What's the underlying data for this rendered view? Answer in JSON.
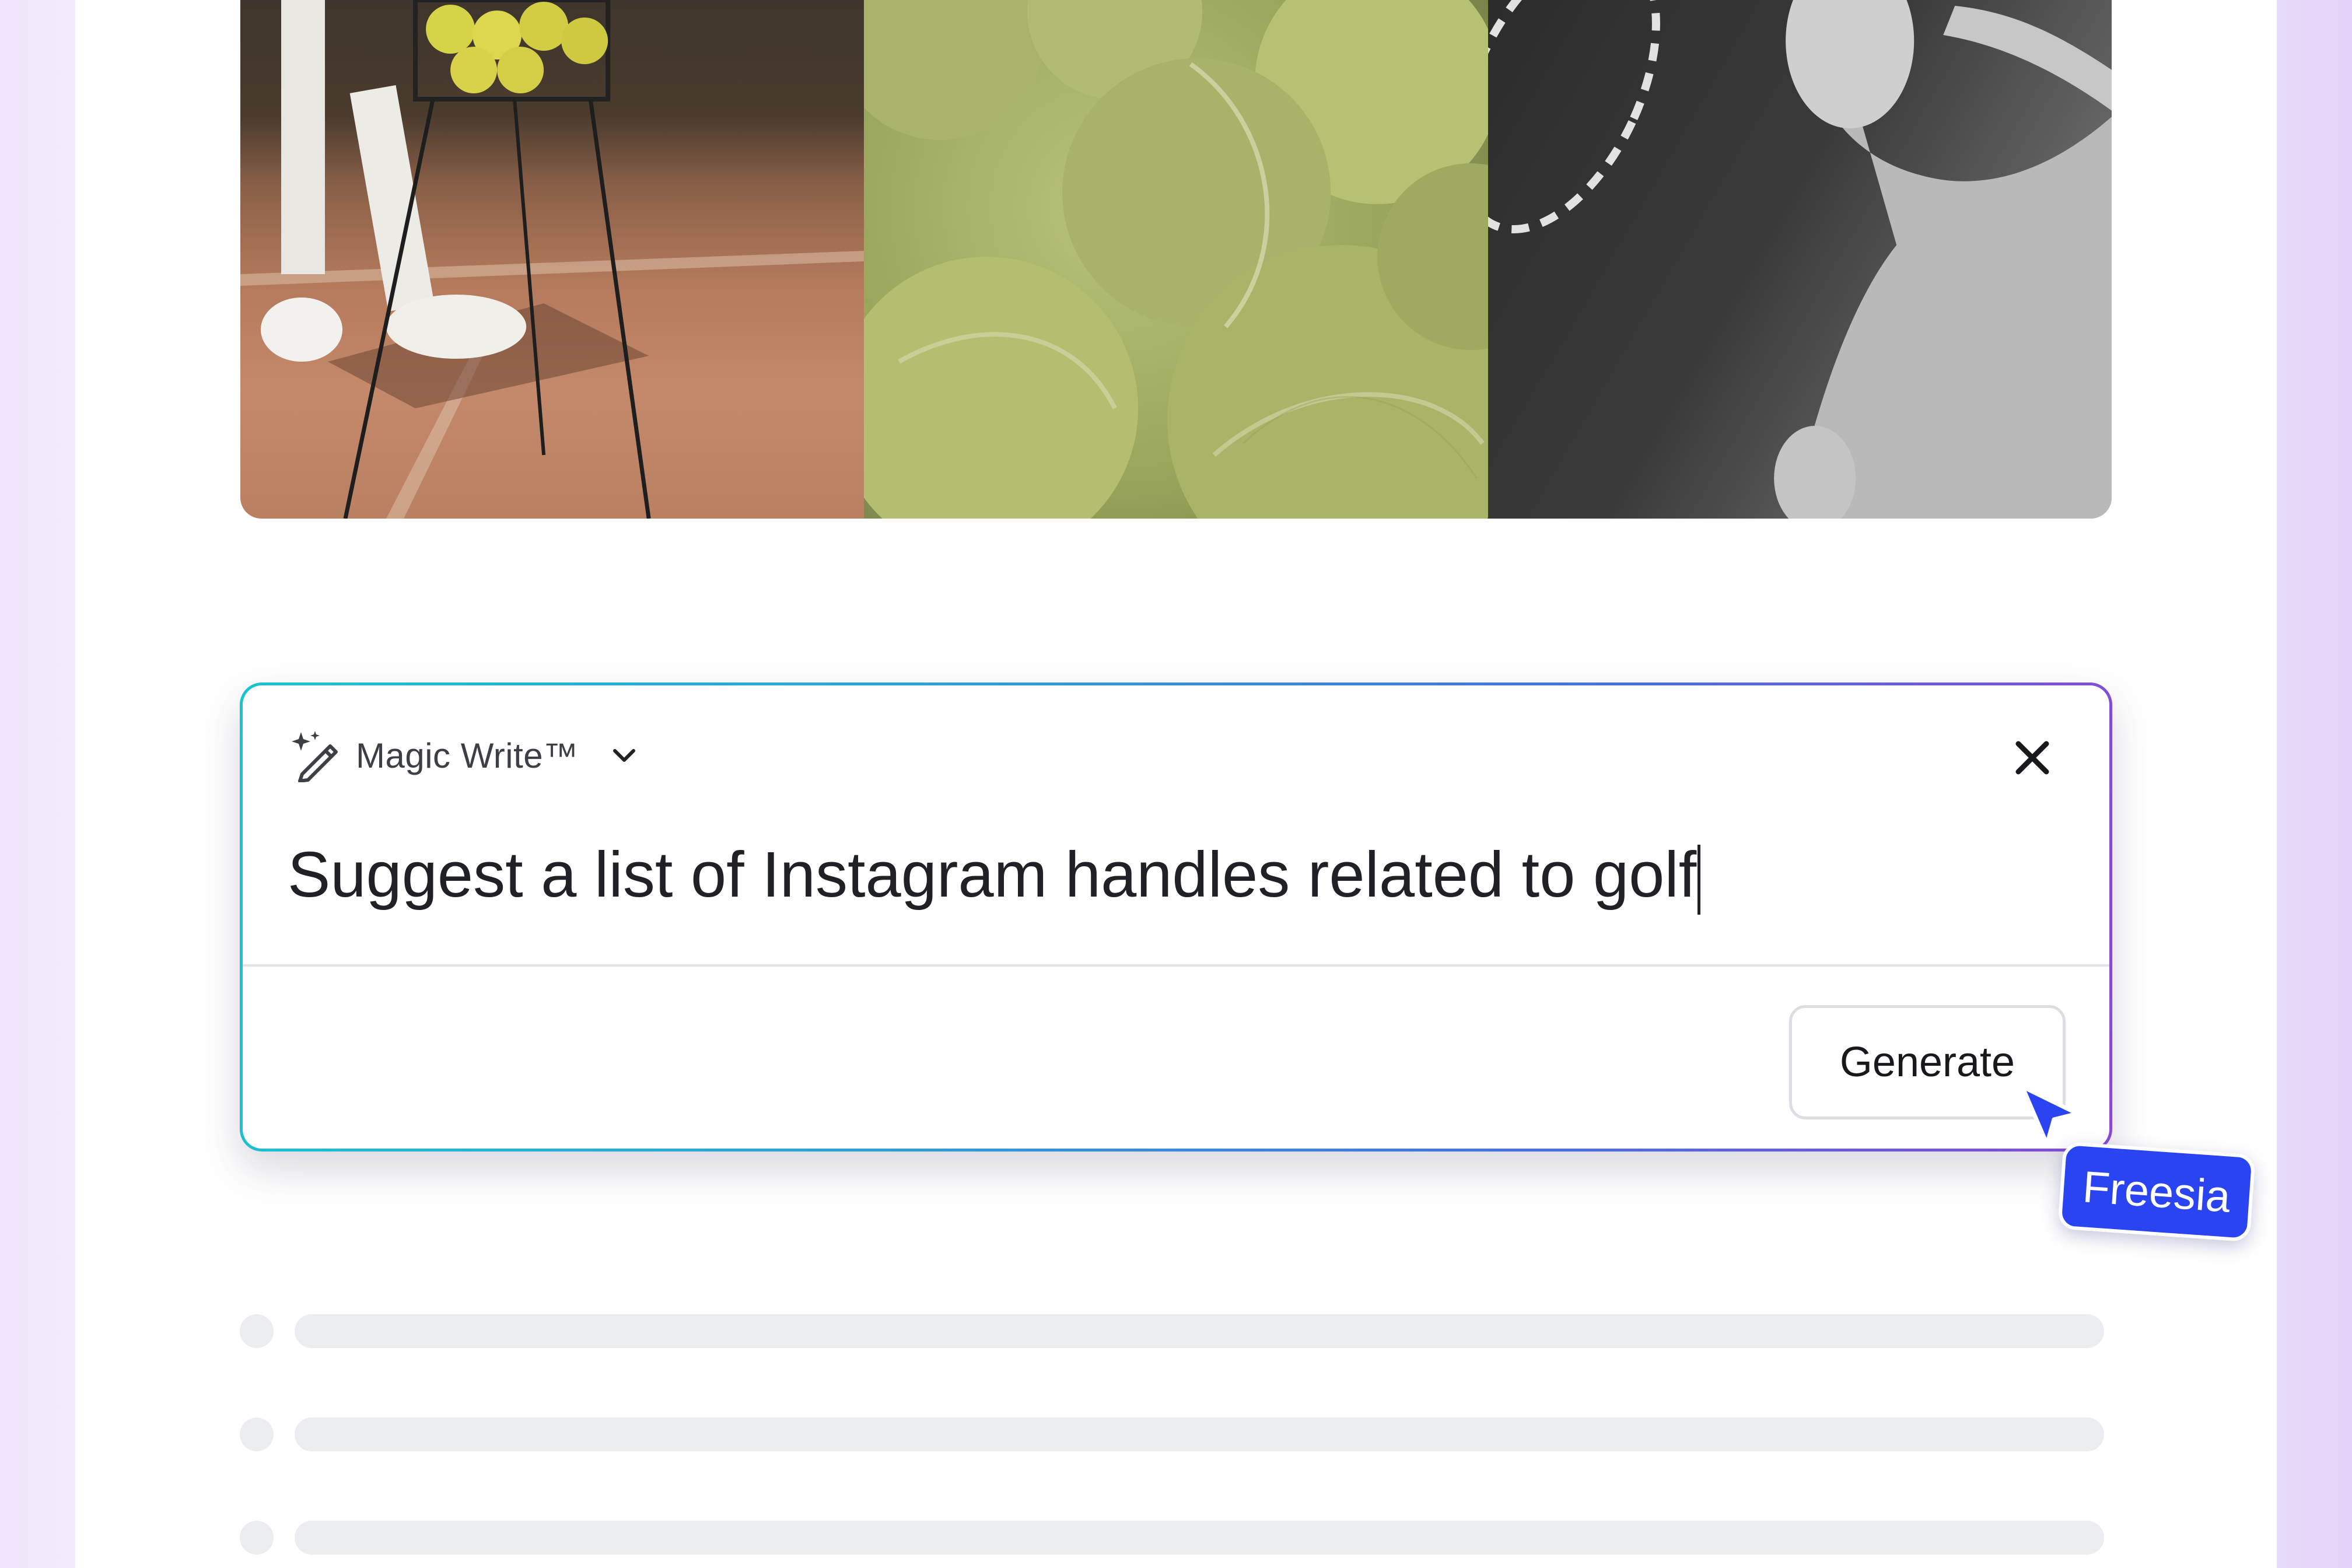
{
  "magic_write": {
    "title": "Magic Write™",
    "prompt_value": "Suggest a list of Instagram handles related to golf",
    "generate_label": "Generate",
    "icons": {
      "wand": "magic-wand-icon",
      "dropdown": "chevron-down-icon",
      "close": "close-icon"
    }
  },
  "collaborator": {
    "name": "Freesia",
    "color": "#2a44f2"
  },
  "colors": {
    "gradient_start": "#19c3cf",
    "gradient_end": "#8a49d6",
    "skeleton": "#ecedf1"
  }
}
